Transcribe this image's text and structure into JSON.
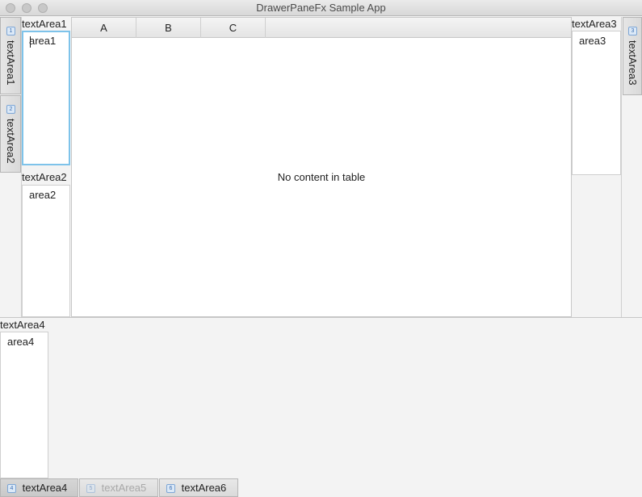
{
  "window": {
    "title": "DrawerPaneFx Sample App"
  },
  "left_drawer": {
    "tabs": [
      {
        "num": "1",
        "label": "textArea1"
      },
      {
        "num": "2",
        "label": "textArea2"
      }
    ],
    "panes": [
      {
        "label": "textArea1",
        "text": "area1"
      },
      {
        "label": "textArea2",
        "text": "area2"
      }
    ]
  },
  "table": {
    "columns": [
      "A",
      "B",
      "C"
    ],
    "placeholder": "No content in table"
  },
  "right_drawer": {
    "tab": {
      "num": "3",
      "label": "textArea3"
    },
    "pane": {
      "label": "textArea3",
      "text": "area3"
    }
  },
  "bottom_drawer": {
    "pane": {
      "label": "textArea4",
      "text": "area4"
    },
    "tabs": [
      {
        "num": "4",
        "label": "textArea4",
        "state": "selected"
      },
      {
        "num": "5",
        "label": "textArea5",
        "state": "disabled"
      },
      {
        "num": "6",
        "label": "textArea6",
        "state": "normal"
      }
    ]
  }
}
